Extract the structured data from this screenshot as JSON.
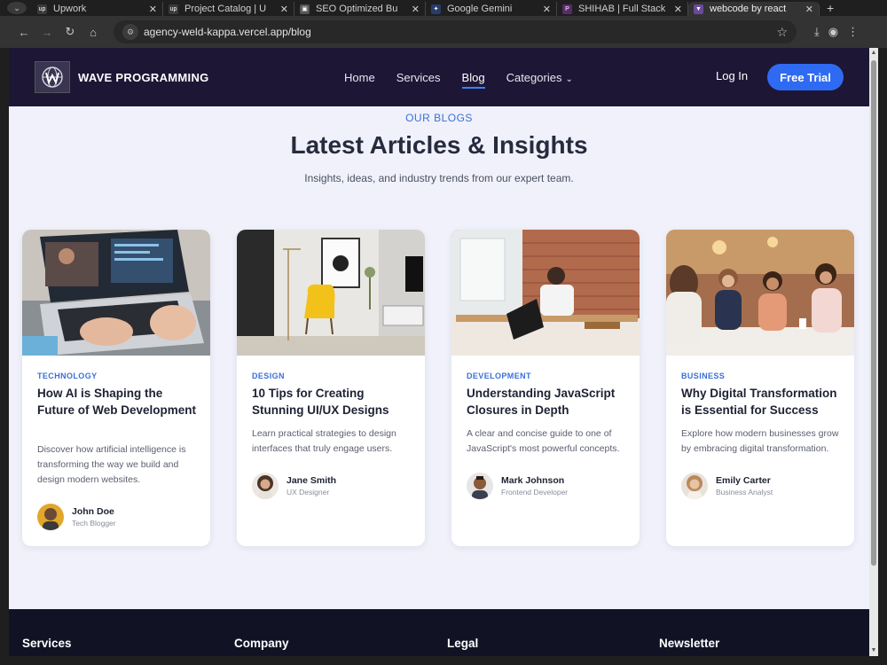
{
  "browser": {
    "tabs": [
      {
        "title": "Upwork",
        "fav": "up",
        "favColor": "#3a3a3a"
      },
      {
        "title": "Project Catalog | U",
        "fav": "up",
        "favColor": "#3a3a3a"
      },
      {
        "title": "SEO Optimized Bu",
        "fav": "▣",
        "favColor": "#555"
      },
      {
        "title": "Google Gemini",
        "fav": "✦",
        "favColor": "#2a3a6a"
      },
      {
        "title": "SHIHAB | Full Stack",
        "fav": "P",
        "favColor": "#5a2a6a"
      },
      {
        "title": "webcode by react",
        "fav": "▼",
        "favColor": "#6a4a9a",
        "active": true
      }
    ],
    "url": "agency-weld-kappa.vercel.app/blog"
  },
  "nav": {
    "brand": "WAVE PROGRAMMING",
    "items": [
      "Home",
      "Services",
      "Blog",
      "Categories"
    ],
    "active_item": "Blog",
    "login": "Log In",
    "cta": "Free Trial"
  },
  "hero": {
    "eyebrow": "OUR BLOGS",
    "title": "Latest Articles & Insights",
    "subtitle": "Insights, ideas, and industry trends from our expert team."
  },
  "posts": [
    {
      "category": "TECHNOLOGY",
      "title": "How AI is Shaping the Future of Web Development",
      "description": "Discover how artificial intelligence is transforming the way we build and design modern websites.",
      "author": "John Doe",
      "role": "Tech Blogger",
      "image": "laptop-typing"
    },
    {
      "category": "DESIGN",
      "title": "10 Tips for Creating Stunning UI/UX Designs",
      "description": "Learn practical strategies to design interfaces that truly engage users.",
      "author": "Jane Smith",
      "role": "UX Designer",
      "image": "interior-yellow-chair"
    },
    {
      "category": "DEVELOPMENT",
      "title": "Understanding JavaScript Closures in Depth",
      "description": "A clear and concise guide to one of JavaScript's most powerful concepts.",
      "author": "Mark Johnson",
      "role": "Frontend Developer",
      "image": "developer-brick-wall"
    },
    {
      "category": "BUSINESS",
      "title": "Why Digital Transformation is Essential for Success",
      "description": "Explore how modern businesses grow by embracing digital transformation.",
      "author": "Emily Carter",
      "role": "Business Analyst",
      "image": "team-cafe-meeting"
    }
  ],
  "footer": {
    "columns": [
      "Services",
      "Company",
      "Legal",
      "Newsletter"
    ]
  },
  "colors": {
    "nav_bg": "#1e1635",
    "accent": "#2f6bf2",
    "category": "#3b6fd8",
    "page_bg": "#f0f1fa",
    "footer_bg": "#111325"
  }
}
